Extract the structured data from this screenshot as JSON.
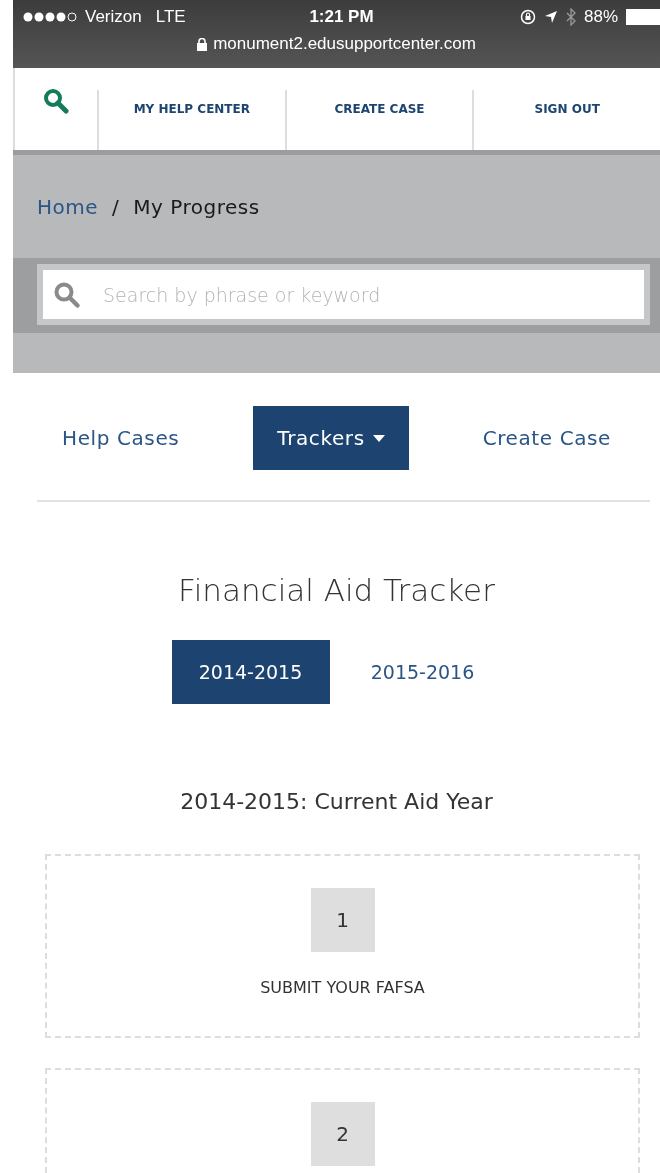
{
  "status_bar": {
    "carrier": "Verizon",
    "network": "LTE",
    "time": "1:21 PM",
    "battery": "88%",
    "url": "monument2.edusupportcenter.com"
  },
  "top_nav": {
    "items": [
      {
        "label": "MY HELP CENTER"
      },
      {
        "label": "CREATE CASE"
      },
      {
        "label": "SIGN OUT"
      }
    ]
  },
  "breadcrumb": [
    {
      "label": "Home",
      "kind": "link"
    },
    {
      "label": "/",
      "kind": "separator"
    },
    {
      "label": "My Progress",
      "kind": "current"
    }
  ],
  "search": {
    "placeholder": "Search by phrase or keyword"
  },
  "tabs": [
    {
      "label": "Help Cases",
      "selected": false,
      "dropdown": false
    },
    {
      "label": "Trackers",
      "selected": true,
      "dropdown": true
    },
    {
      "label": "Create Case",
      "selected": false,
      "dropdown": false
    }
  ],
  "title": "Financial Aid Tracker",
  "years": [
    {
      "label": "2014-2015",
      "selected": true
    },
    {
      "label": "2015-2016",
      "selected": false
    }
  ],
  "subtitle": "2014-2015: Current Aid Year",
  "steps": [
    {
      "number": "1",
      "label": "SUBMIT YOUR FAFSA"
    },
    {
      "number": "2"
    }
  ]
}
